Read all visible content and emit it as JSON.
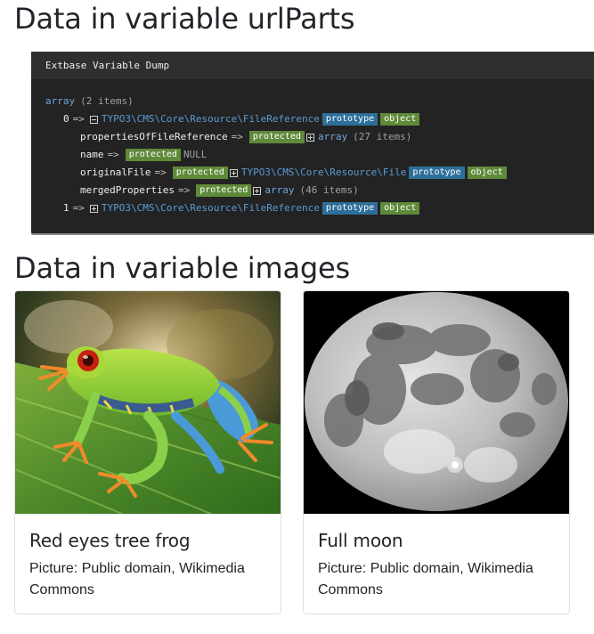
{
  "sections": {
    "urlparts_heading": "Data in variable urlParts",
    "images_heading": "Data in variable images"
  },
  "dump": {
    "title": "Extbase Variable Dump",
    "root_type": "array",
    "root_count": "(2 items)",
    "item0_index": "0",
    "item0_class": "TYPO3\\CMS\\Core\\Resource\\FileReference",
    "tag_prototype": "prototype",
    "tag_object": "object",
    "tag_protected": "protected",
    "arrow": "=>",
    "prop1_name": "propertiesOfFileReference",
    "prop1_type": "array",
    "prop1_count": "(27 items)",
    "prop2_name": "name",
    "prop2_value": "NULL",
    "prop3_name": "originalFile",
    "prop3_class": "TYPO3\\CMS\\Core\\Resource\\File",
    "prop4_name": "mergedProperties",
    "prop4_type": "array",
    "prop4_count": "(46 items)",
    "item1_index": "1",
    "item1_class": "TYPO3\\CMS\\Core\\Resource\\FileReference"
  },
  "cards": [
    {
      "title": "Red eyes tree frog",
      "text": "Picture: Public domain, Wikimedia Commons"
    },
    {
      "title": "Full moon",
      "text": "Picture: Public domain, Wikimedia Commons"
    }
  ],
  "colors": {
    "dump_bg": "#232323",
    "keyword_blue": "#6fa8dc",
    "prototype_tag": "#2d6f99",
    "object_tag": "#5f8a3a"
  }
}
